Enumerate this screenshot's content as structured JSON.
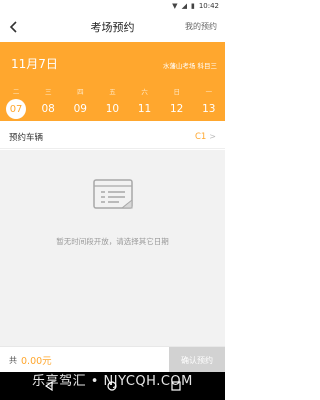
{
  "status": {
    "time": "10:42",
    "icons": [
      "wifi-icon",
      "signal-icon",
      "battery-icon"
    ]
  },
  "header": {
    "title": "考场预约",
    "right_link": "我的预约",
    "back_icon": "chevron-left-icon"
  },
  "calendar": {
    "selected_date": "11月7日",
    "location": "水藩山考场  科目三",
    "weekdays": [
      "二",
      "三",
      "四",
      "五",
      "六",
      "日",
      "一"
    ],
    "days": [
      "07",
      "08",
      "09",
      "10",
      "11",
      "12",
      "13"
    ],
    "selected_index": 0
  },
  "vehicle": {
    "label": "预约车辆",
    "value": "C1"
  },
  "empty_state": {
    "icon": "document-icon",
    "text": "暂无时间段开放，请选择其它日期"
  },
  "footer": {
    "total_label": "共",
    "total_amount": "0.00元",
    "confirm_label": "确认预约"
  },
  "watermark": "乐享驾汇 • NJYCQH.COM",
  "colors": {
    "accent": "#ffa72e",
    "disabled": "#d2d2d2",
    "background": "#f2f2f2"
  }
}
